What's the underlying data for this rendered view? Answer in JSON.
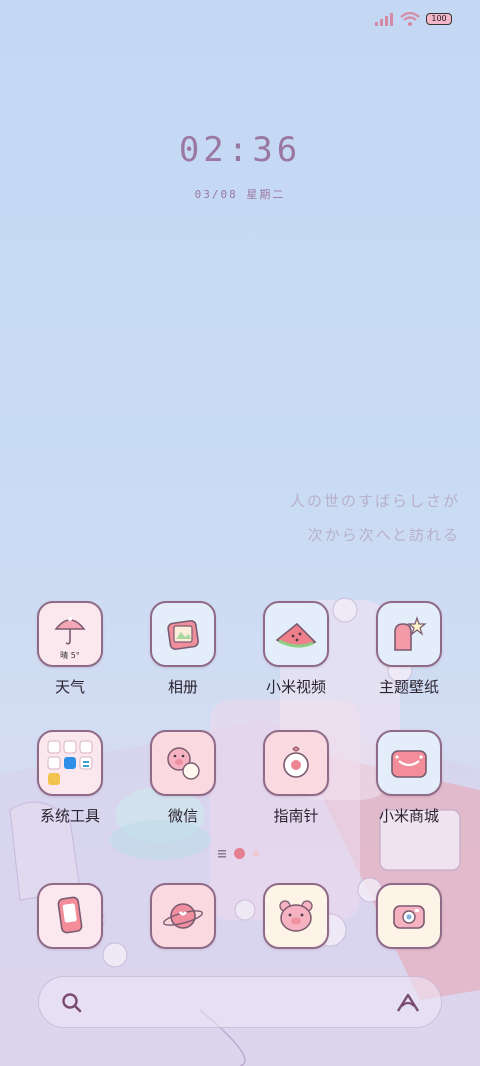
{
  "status_bar": {
    "battery": "100"
  },
  "lockscreen": {
    "time": "02:36",
    "date": "03/08 星期二",
    "quote_line1": "人の世のすばらしさが",
    "quote_line2": "次から次へと訪れる"
  },
  "apps_row1": [
    {
      "label": "天气",
      "icon": "weather-umbrella-icon",
      "weather": "晴 5°"
    },
    {
      "label": "相册",
      "icon": "photo-album-icon"
    },
    {
      "label": "小米视频",
      "icon": "watermelon-video-icon"
    },
    {
      "label": "主题壁纸",
      "icon": "theme-wallpaper-icon"
    }
  ],
  "apps_row2": [
    {
      "label": "系统工具",
      "icon": "system-tools-folder-icon"
    },
    {
      "label": "微信",
      "icon": "wechat-pig-icon"
    },
    {
      "label": "指南针",
      "icon": "compass-icon"
    },
    {
      "label": "小米商城",
      "icon": "mi-store-icon"
    }
  ],
  "dock": [
    {
      "icon": "phone-icon"
    },
    {
      "icon": "planet-browser-icon"
    },
    {
      "icon": "bear-messages-icon"
    },
    {
      "icon": "camera-icon"
    }
  ],
  "colors": {
    "icon_blue": "#e4eefa",
    "icon_pink": "#fbd9e0",
    "icon_cream": "#fdf3e6",
    "outline": "#8f6b88",
    "accent_pink": "#e57f8f"
  }
}
